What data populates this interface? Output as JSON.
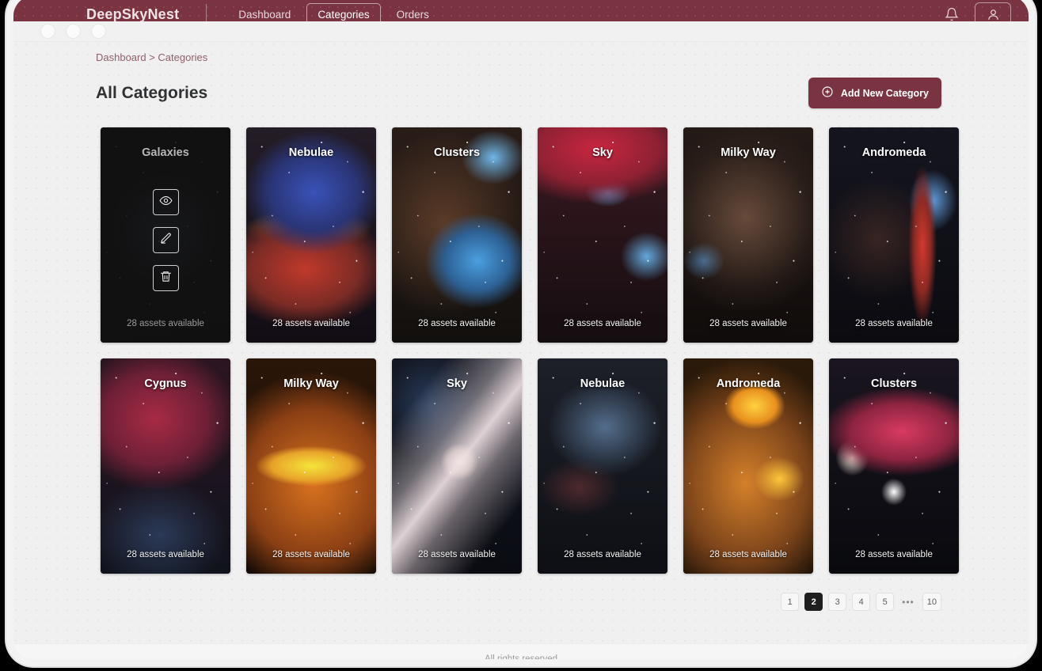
{
  "navbar": {
    "brand": "DeepSkyNest",
    "links": [
      {
        "label": "Dashboard",
        "active": false
      },
      {
        "label": "Categories",
        "active": true
      },
      {
        "label": "Orders",
        "active": false
      }
    ],
    "notification_icon": "bell-icon",
    "profile_icon": "user-icon"
  },
  "breadcrumb": "Dashboard > Categories",
  "header": {
    "title": "All Categories",
    "add_button": "Add New Category",
    "add_button_icon": "plus-circle-icon"
  },
  "cards": [
    {
      "name": "Galaxies",
      "count": "28 assets available",
      "hovered": true,
      "art": "radial-gradient(ellipse 60% 38% at 50% 48%, rgba(90,105,140,0.55), rgba(40,45,60,0.2) 60%, transparent 75%), linear-gradient(170deg,#141418,#0d0d11)"
    },
    {
      "name": "Nebulae",
      "count": "28 assets available",
      "hovered": false,
      "art": "radial-gradient(ellipse 75% 40% at 52% 30%, #3a52b8 0%, #2a3576 45%, transparent 72%), radial-gradient(ellipse 85% 35% at 45% 66%, #c0392b 0%, #7a2b25 50%, transparent 78%), radial-gradient(ellipse 70% 14% at 48% 47%, #d98a3a 0%, transparent 70%), linear-gradient(180deg,#241c26,#120d14)"
    },
    {
      "name": "Clusters",
      "count": "28 assets available",
      "hovered": false,
      "art": "radial-gradient(ellipse 55% 30% at 66% 62%, #4a9fe0 0%, #2d6195 45%, transparent 74%), radial-gradient(ellipse 35% 18% at 78% 14%, #6fb6e8 0%, transparent 70%), radial-gradient(ellipse 90% 60% at 40% 45%, rgba(150,95,60,0.5), transparent 72%), linear-gradient(180deg,#2a1d18,#12100e)"
    },
    {
      "name": "Sky",
      "count": "28 assets available",
      "hovered": false,
      "art": "radial-gradient(ellipse 95% 32% at 45% 10%, #c8263f 0%, #8e2133 50%, transparent 80%), radial-gradient(ellipse 28% 16% at 84% 60%, #63a9dd 0%, transparent 72%), radial-gradient(ellipse 25% 10% at 54% 30%, #5d93c9 0%, transparent 70%), linear-gradient(180deg,#3a1a22,#140d10)"
    },
    {
      "name": "Milky Way",
      "count": "28 assets available",
      "hovered": false,
      "art": "radial-gradient(ellipse 85% 55% at 48% 42%, rgba(128,92,72,0.75), rgba(60,44,36,0.35) 60%, transparent 80%), radial-gradient(ellipse 22% 12% at 16% 62%, #4a8fd0 0%, transparent 72%), linear-gradient(180deg,#241a16,#100c0b)"
    },
    {
      "name": "Andromeda",
      "count": "28 assets available",
      "hovered": false,
      "art": "radial-gradient(ellipse 14% 48% at 72% 55%, #d1392f 0%, #8d2a24 45%, transparent 78%), radial-gradient(ellipse 26% 20% at 80% 34%, #5f9ad8 0%, transparent 72%), radial-gradient(ellipse 60% 38% at 38% 52%, rgba(120,70,50,0.38), transparent 75%), linear-gradient(180deg,#15151f,#0b0b10)"
    },
    {
      "name": "Cygnus",
      "count": "28 assets available",
      "hovered": false,
      "art": "radial-gradient(ellipse 80% 42% at 42% 28%, #a82a45 0%, #6e2036 50%, transparent 80%), radial-gradient(ellipse 70% 34% at 45% 82%, #2b3a58 0%, transparent 76%), linear-gradient(180deg,#2b1520,#10131c)"
    },
    {
      "name": "Milky Way",
      "count": "28 assets available",
      "hovered": false,
      "art": "radial-gradient(ellipse 55% 12% at 50% 50%, #f5e53a 0%, #e8a32a 55%, transparent 78%), radial-gradient(ellipse 95% 62% at 52% 58%, #d9731f 0%, #8a3f14 55%, transparent 84%), linear-gradient(180deg,#2a1608,#140a05)"
    },
    {
      "name": "Sky",
      "count": "28 assets available",
      "hovered": false,
      "art": "linear-gradient(128deg, transparent 18%, rgba(200,190,195,0.5) 38%, rgba(240,225,228,0.92) 50%, rgba(200,185,190,0.5) 62%, transparent 82%), radial-gradient(ellipse 20% 12% at 52% 48%, #fff3ea 0%, rgba(255,225,205,0.6) 45%, transparent 72%), radial-gradient(ellipse 55% 35% at 30% 22%, rgba(70,110,170,0.45), transparent 72%), linear-gradient(180deg,#131722,#0a0c12)"
    },
    {
      "name": "Nebulae",
      "count": "28 assets available",
      "hovered": false,
      "art": "radial-gradient(ellipse 58% 30% at 52% 32%, rgba(120,160,205,0.62), transparent 76%), radial-gradient(ellipse 42% 18% at 32% 60%, rgba(165,70,70,0.4), transparent 74%), linear-gradient(180deg,#1d2029,#0d0f14)"
    },
    {
      "name": "Andromeda",
      "count": "28 assets available",
      "hovered": false,
      "art": "radial-gradient(ellipse 30% 14% at 55% 22%, #ffd23f 0%, #e8901f 55%, transparent 78%), radial-gradient(ellipse 26% 14% at 74% 56%, #ffc63a 0%, transparent 74%), radial-gradient(ellipse 95% 70% at 48% 58%, #d4802a 0%, #7c441a 50%, transparent 84%), linear-gradient(180deg,#2b1a09,#140c06)"
    },
    {
      "name": "Clusters",
      "count": "28 assets available",
      "hovered": false,
      "art": "radial-gradient(ellipse 78% 26% at 56% 34%, #d93a62 0%, #8d2440 50%, transparent 80%), radial-gradient(ellipse 18% 12% at 18% 46%, #f0e2d6 0%, transparent 72%), radial-gradient(ellipse 14% 9% at 50% 62%, #ffffff 0%, transparent 70%), linear-gradient(180deg,#1a1520,#090a0e)"
    }
  ],
  "card_actions": [
    {
      "name": "view-action",
      "icon": "eye-icon"
    },
    {
      "name": "edit-action",
      "icon": "pencil-icon"
    },
    {
      "name": "delete-action",
      "icon": "trash-icon"
    }
  ],
  "pagination": {
    "pages": [
      "1",
      "2",
      "3",
      "4",
      "5"
    ],
    "ellipsis": "•••",
    "last": "10",
    "active": "2"
  },
  "footer": {
    "text": "All rights reserved"
  },
  "colors": {
    "brand_maroon": "#7a3341",
    "page_background": "#f0f0f0",
    "breadcrumb": "#8d5f68",
    "title": "#2f3133",
    "pagination_active": "#1f1f1f"
  }
}
